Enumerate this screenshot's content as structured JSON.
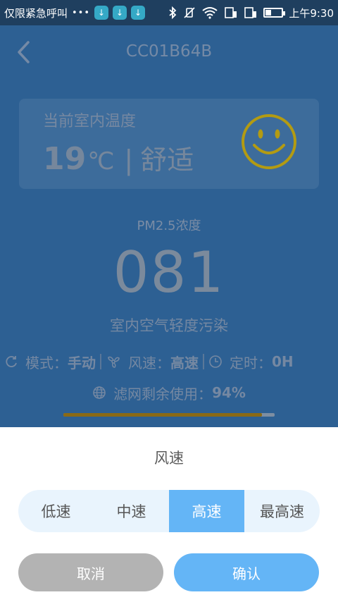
{
  "status_bar": {
    "carrier_text": "仅限紧急呼叫",
    "overflow": "•••",
    "download_icons": [
      "download-icon",
      "download-icon",
      "download-icon"
    ],
    "right_icons": [
      "bluetooth-icon",
      "vibrate-off-icon",
      "wifi-icon",
      "sim1-icon",
      "sim2-icon",
      "battery-icon"
    ],
    "time": "上午9:30"
  },
  "header": {
    "title": "CC01B64B",
    "back_icon": "chevron-left-icon"
  },
  "temperature_card": {
    "label": "当前室内温度",
    "value": "19",
    "unit": "℃",
    "separator": "|",
    "comfort": "舒适",
    "face_icon": "smiley-icon",
    "face_color": "#c9b300"
  },
  "pm25": {
    "label": "PM2.5浓度",
    "value": "081",
    "description": "室内空气轻度污染"
  },
  "status": {
    "mode_label": "模式：",
    "mode_value": "手动",
    "speed_label": "风速：",
    "speed_value": "高速",
    "timer_label": "定时：",
    "timer_value": "0H"
  },
  "filter": {
    "label": "滤网剩余使用：",
    "value": "94%",
    "progress": 0.94,
    "bar_color": "#8a6a16"
  },
  "sheet": {
    "title": "风速",
    "options": [
      "低速",
      "中速",
      "高速",
      "最高速"
    ],
    "selected_index": 2,
    "cancel_label": "取消",
    "confirm_label": "确认",
    "accent_color": "#64b5f6"
  }
}
